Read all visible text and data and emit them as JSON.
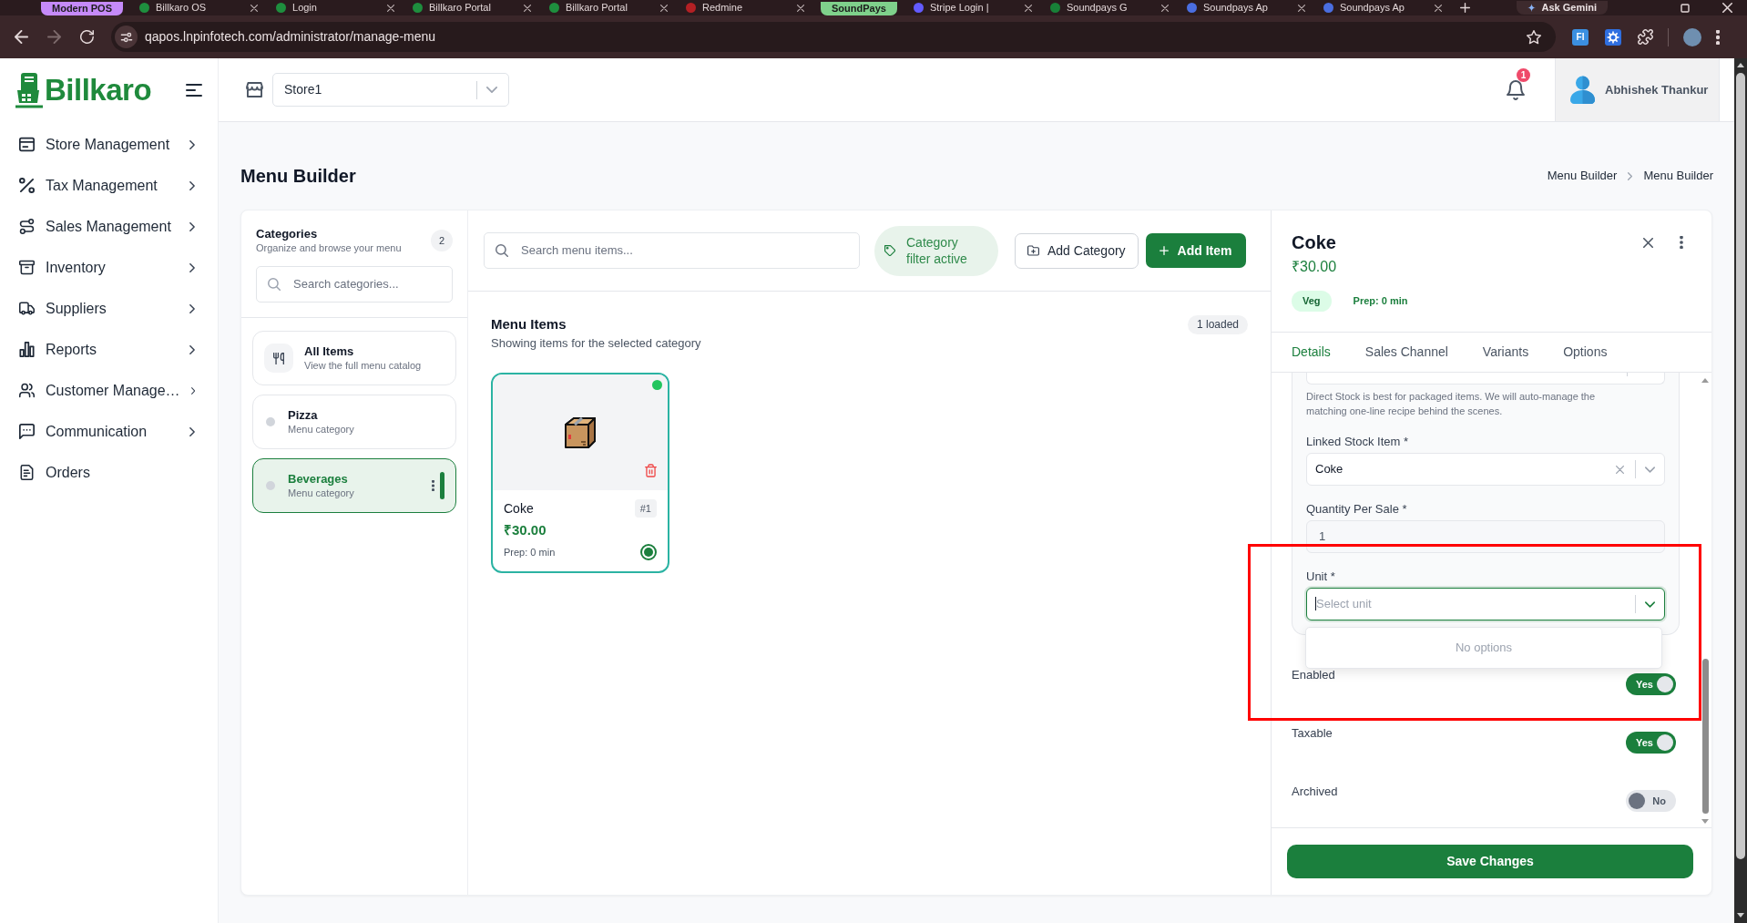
{
  "browser": {
    "tabs": [
      {
        "kind": "group",
        "label": "Modern POS",
        "color": "#c58af9"
      },
      {
        "kind": "tab",
        "label": "Billkaro OS",
        "color": "#1e8e3e"
      },
      {
        "kind": "tab",
        "label": "Login",
        "color": "#1e8e3e"
      },
      {
        "kind": "tab",
        "label": "Billkaro Portal",
        "color": "#1e8e3e"
      },
      {
        "kind": "tab",
        "label": "Billkaro Portal",
        "color": "#1e8e3e"
      },
      {
        "kind": "tab",
        "label": "Redmine",
        "color": "#b32024"
      },
      {
        "kind": "group",
        "label": "SoundPays",
        "color": "#7fd18b"
      },
      {
        "kind": "tab",
        "label": "Stripe Login |",
        "color": "#635bff"
      },
      {
        "kind": "tab",
        "label": "Soundpays G",
        "color": "#188038"
      },
      {
        "kind": "tab",
        "label": "Soundpays Ap",
        "color": "#4a6ee0"
      },
      {
        "kind": "tab",
        "label": "Soundpays Ap",
        "color": "#4a6ee0"
      }
    ],
    "side_button": {
      "label": "Ask Gemini"
    },
    "nav": [
      {
        "kind": "back",
        "disabled": false
      },
      {
        "kind": "forward",
        "disabled": true
      },
      {
        "kind": "reload",
        "disabled": false
      }
    ],
    "url": "qapos.lnpinfotech.com/administrator/manage-menu",
    "extensions": [
      {
        "kind": "text_tile",
        "label": "FI"
      },
      {
        "kind": "gear_tile"
      },
      {
        "kind": "puzzle"
      }
    ]
  },
  "sidebar": {
    "logo": "Billkaro",
    "items": [
      {
        "label": "Store Management",
        "kind": "group"
      },
      {
        "label": "Tax Management",
        "kind": "group"
      },
      {
        "label": "Sales Management",
        "kind": "group"
      },
      {
        "label": "Inventory",
        "kind": "group"
      },
      {
        "label": "Suppliers",
        "kind": "group"
      },
      {
        "label": "Reports",
        "kind": "group"
      },
      {
        "label": "Customer Manage…",
        "kind": "group"
      },
      {
        "label": "Communication",
        "kind": "group"
      },
      {
        "label": "Orders",
        "kind": "link"
      }
    ]
  },
  "header": {
    "store_select": {
      "value": "Store1"
    },
    "notifications": {
      "count": "1"
    },
    "user": {
      "name": "Abhishek Thankur"
    }
  },
  "page": {
    "title": "Menu Builder",
    "breadcrumb": [
      "Menu Builder",
      "Menu Builder"
    ]
  },
  "categories": {
    "title": "Categories",
    "subtitle": "Organize and browse your menu",
    "count": "2",
    "search": {
      "placeholder": "Search categories..."
    },
    "items": [
      {
        "kind": "all",
        "name": "All Items",
        "subtitle": "View the full menu catalog",
        "selected": false
      },
      {
        "kind": "category",
        "name": "Pizza",
        "subtitle": "Menu category",
        "selected": false
      },
      {
        "kind": "category",
        "name": "Beverages",
        "subtitle": "Menu category",
        "selected": true
      }
    ]
  },
  "toolbar": {
    "search": {
      "placeholder": "Search menu items..."
    },
    "filter_chip": "Category filter active",
    "buttons": [
      {
        "label": "Add Category",
        "kind": "secondary"
      },
      {
        "label": "Add Item",
        "kind": "primary"
      }
    ]
  },
  "menu_items": {
    "title": "Menu Items",
    "subtitle": "Showing items for the selected category",
    "count": "1 loaded",
    "items": [
      {
        "name": "Coke",
        "number": "#1",
        "price": "₹30.00",
        "prep": "Prep: 0 min",
        "available": true,
        "selected": true
      }
    ]
  },
  "detail": {
    "title": "Coke",
    "price": "₹30.00",
    "diet": "Veg",
    "prep": "Prep: 0 min",
    "tabs": [
      {
        "label": "Details",
        "selected": true
      },
      {
        "label": "Sales Channel",
        "selected": false
      },
      {
        "label": "Variants",
        "selected": false
      },
      {
        "label": "Options",
        "selected": false
      }
    ],
    "fields": [
      {
        "kind": "clipped"
      },
      {
        "kind": "note",
        "text": "Direct Stock is best for packaged items. We will auto-manage the matching one-line recipe behind the scenes."
      },
      {
        "kind": "select",
        "label": "Linked Stock Item *",
        "value": "Coke",
        "clearable": true,
        "focused": false
      },
      {
        "kind": "input",
        "label": "Quantity Per Sale *",
        "value": "1",
        "disabled": true
      },
      {
        "kind": "select",
        "label": "Unit *",
        "placeholder": "Select unit",
        "clearable": false,
        "focused": true,
        "menu": "No options"
      }
    ],
    "toggles": [
      {
        "label": "Enabled",
        "on": true,
        "text": "Yes"
      },
      {
        "label": "Taxable",
        "on": true,
        "text": "Yes"
      },
      {
        "label": "Archived",
        "on": false,
        "text": "No"
      }
    ],
    "save_button": "Save Changes"
  },
  "annotation": {
    "kind": "rectangle"
  }
}
